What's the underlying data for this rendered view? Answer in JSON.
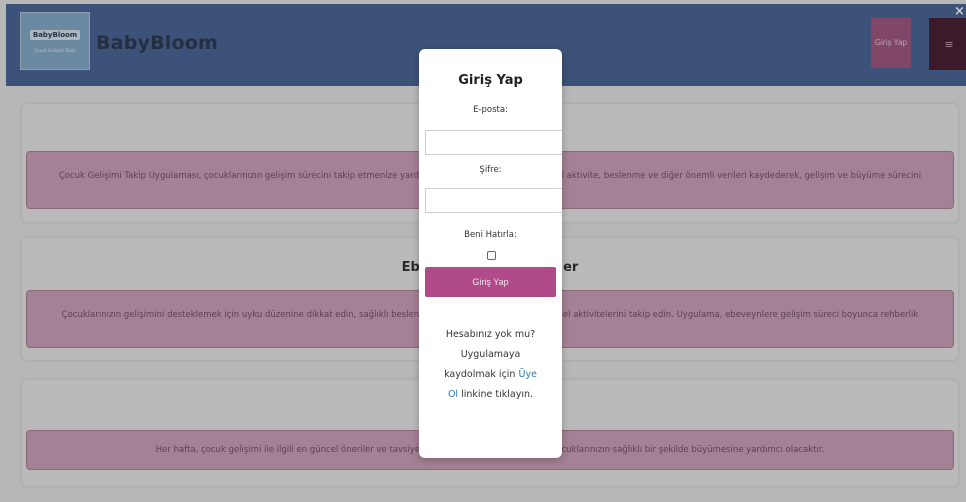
{
  "header": {
    "logo_word": "BabyBloom",
    "logo_sub": "Çocuk Gelişimi Takip",
    "brand": "BabyBloom",
    "login_button": "Giriş Yap",
    "menu_icon": "≡",
    "close_icon": "×"
  },
  "cards": [
    {
      "title": "",
      "text": "Çocuk Gelişimi Takip Uygulaması, çocuklarınızın gelişim sürecini takip etmenize yardımcı olur. Uygulama, uyku, fiziksel aktivite, beslenme ve diğer önemli verileri kaydederek, gelişim ve büyüme sürecini izlemenizi sağlar."
    },
    {
      "title": "Ebeveynler İçin Öneriler",
      "text": "Çocuklarınızın gelişimini desteklemek için uyku düzenine dikkat edin, sağlıklı beslenme alışkanlıkları gösterin ve fiziksel aktivitelerini takip edin. Uygulama, ebeveynlere gelişim süreci boyunca rehberlik eder ve öneriler sunar."
    },
    {
      "title": "",
      "text": "Her hafta, çocuk gelişimi ile ilgili en güncel öneriler ve tavsiyeler sunulmaktadır. Bu öneriler, çocuklarınızın sağlıklı bir şekilde büyümesine yardımcı olacaktır."
    }
  ],
  "modal": {
    "title": "Giriş Yap",
    "email_label": "E-posta:",
    "email_value": "",
    "password_label": "Şifre:",
    "password_value": "",
    "remember_label": "Beni Hatırla:",
    "submit_label": "Giriş Yap",
    "signup_prefix": "Hesabınız yok mu? Uygulamaya kaydolmak için",
    "signup_link": "Üye Ol",
    "signup_suffix": "linkine tıklayın."
  },
  "colors": {
    "header_bg": "#3e5a8f",
    "login_button_bg": "#9b4c79",
    "menu_button_bg": "#3b0f22",
    "card_text_bg": "#cc9cb6",
    "submit_bg": "#b04a89",
    "link": "#2b79b5"
  }
}
